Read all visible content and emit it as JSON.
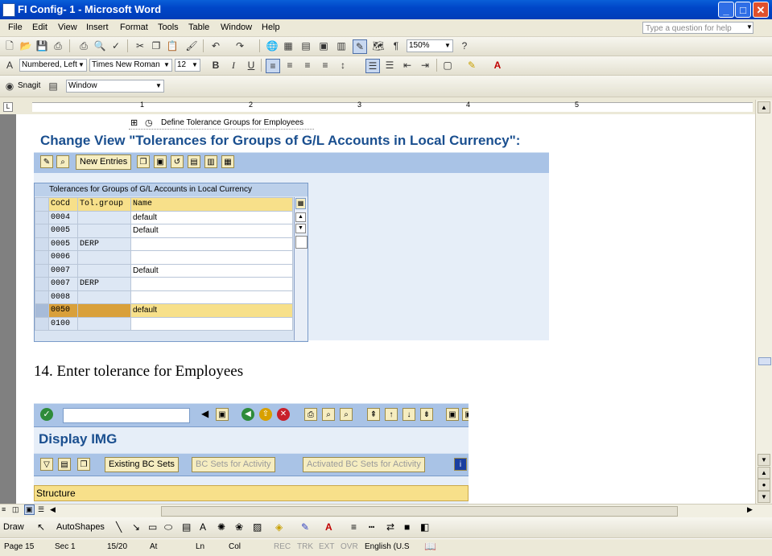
{
  "window": {
    "title": "FI Config- 1 - Microsoft Word",
    "minimize": "_",
    "maximize": "□",
    "close": "✕"
  },
  "menu": {
    "items": [
      "File",
      "Edit",
      "View",
      "Insert",
      "Format",
      "Tools",
      "Table",
      "Window",
      "Help"
    ],
    "help_placeholder": "Type a question for help"
  },
  "toolbar_standard": {
    "zoom": "150%"
  },
  "toolbar_format": {
    "style": "Numbered, Left",
    "font": "Times New Roman",
    "size": "12",
    "bold": "B",
    "italic": "I",
    "underline": "U"
  },
  "toolbar_snagit": {
    "snagit_label": "Snagit",
    "capture_mode": "Window"
  },
  "ruler": {
    "marks": [
      "1",
      "2",
      "3",
      "4",
      "5"
    ]
  },
  "document": {
    "tree_item": "Define Tolerance Groups for Employees",
    "sap_title": "Change View \"Tolerances for Groups of G/L Accounts in Local Currency\":",
    "new_entries": "New Entries",
    "table": {
      "caption": "Tolerances for Groups of G/L Accounts in Local Currency",
      "headers": [
        "CoCd",
        "Tol.group",
        "Name"
      ],
      "rows": [
        [
          "0004",
          "",
          "default"
        ],
        [
          "0005",
          "",
          "Default"
        ],
        [
          "0005",
          "DERP",
          ""
        ],
        [
          "0006",
          "",
          ""
        ],
        [
          "0007",
          "",
          "Default"
        ],
        [
          "0007",
          "DERP",
          ""
        ],
        [
          "0008",
          "",
          ""
        ],
        [
          "0050",
          "",
          "default"
        ],
        [
          "0100",
          "",
          ""
        ]
      ],
      "selected_row": 7
    },
    "step_text": "14. Enter tolerance for Employees",
    "img_title": "Display IMG",
    "img_buttons": [
      "Existing BC Sets",
      "BC Sets for Activity",
      "Activated BC Sets for Activity"
    ],
    "structure_label": "Structure"
  },
  "drawbar": {
    "draw": "Draw",
    "autoshapes": "AutoShapes"
  },
  "status": {
    "page": "Page 15",
    "sec": "Sec 1",
    "pages": "15/20",
    "at": "At",
    "ln": "Ln",
    "col": "Col",
    "rec": "REC",
    "trk": "TRK",
    "ext": "EXT",
    "ovr": "OVR",
    "language": "English (U.S"
  },
  "colors": {
    "sap_header": "#1a4f8f",
    "sap_bar": "#a9c3e6",
    "title_bar": "#0a5fd8",
    "selected_row": "#f7e08a"
  }
}
